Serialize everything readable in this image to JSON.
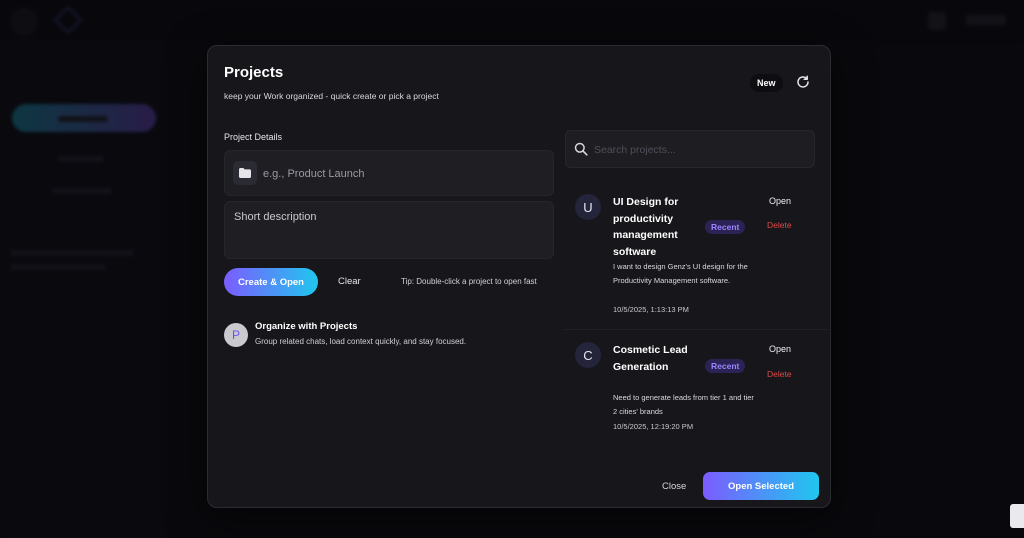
{
  "modal": {
    "title": "Projects",
    "subtitle": "keep your Work organized - quick create or pick a project",
    "new_label": "New",
    "refresh_icon": "refresh-icon"
  },
  "form": {
    "section_label": "Project Details",
    "name_placeholder": "e.g., Product Launch",
    "name_value": "",
    "description_placeholder": "Short description",
    "description_value": "",
    "create_label": "Create & Open",
    "clear_label": "Clear",
    "tip": "Tip: Double-click a project to open fast"
  },
  "info": {
    "icon_letter": "P",
    "title": "Organize with Projects",
    "description": "Group related chats, load context quickly, and stay focused."
  },
  "search": {
    "placeholder": "Search projects...",
    "value": ""
  },
  "projects": [
    {
      "initial": "U",
      "title": "UI Design for productivity management software",
      "badge": "Recent",
      "description": "I want to design Genz's UI design for the Productivity Management software.",
      "timestamp": "10/5/2025, 1:13:13 PM",
      "open_label": "Open",
      "delete_label": "Delete"
    },
    {
      "initial": "C",
      "title": "Cosmetic Lead Generation",
      "badge": "Recent",
      "description": "Need to generate leads from tier 1 and tier 2 cities' brands",
      "timestamp": "10/5/2025, 12:19:20 PM",
      "open_label": "Open",
      "delete_label": "Delete"
    }
  ],
  "footer": {
    "close_label": "Close",
    "open_selected_label": "Open Selected"
  },
  "colors": {
    "accent_start": "#7b5cff",
    "accent_end": "#20c7ee",
    "danger": "#e04848",
    "badge_text": "#9d84ff"
  }
}
